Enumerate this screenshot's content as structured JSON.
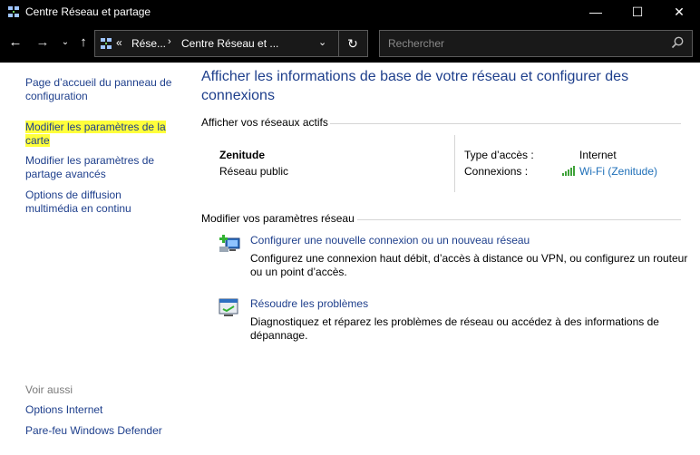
{
  "window": {
    "title": "Centre Réseau et partage",
    "controls": {
      "minimize": "—",
      "maximize": "☐",
      "close": "✕"
    }
  },
  "address_bar": {
    "back": "←",
    "forward": "→",
    "recent": "⌄",
    "up": "↑",
    "crumb_sep": "«",
    "crumb1": "Rése...",
    "crumb_arrow": "›",
    "crumb2": "Centre Réseau et ...",
    "dropdown": "⌄",
    "refresh": "↻",
    "search_placeholder": "Rechercher"
  },
  "sidebar": {
    "links": [
      {
        "label": "Page d’accueil du panneau de configuration"
      },
      {
        "label": "Modifier les paramètres de la carte"
      },
      {
        "label": "Modifier les paramètres de partage avancés"
      },
      {
        "label": "Options de diffusion multimédia en continu"
      }
    ],
    "see_also": "Voir aussi",
    "see_also_links": [
      {
        "label": "Options Internet"
      },
      {
        "label": "Pare-feu Windows Defender"
      }
    ]
  },
  "main": {
    "heading": "Afficher les informations de base de votre réseau et configurer des connexions",
    "active_networks": {
      "title": "Afficher vos réseaux actifs",
      "network_name": "Zenitude",
      "network_type": "Réseau public",
      "access_type_label": "Type d’accès :",
      "access_type_value": "Internet",
      "connections_label": "Connexions :",
      "connections_value": "Wi-Fi (Zenitude)"
    },
    "change_settings": {
      "title": "Modifier vos paramètres réseau",
      "tasks": [
        {
          "link": "Configurer une nouvelle connexion ou un nouveau réseau",
          "description": "Configurez une connexion haut débit, d’accès à distance ou VPN, ou configurez un routeur ou un point d’accès."
        },
        {
          "link": "Résoudre les problèmes",
          "description": "Diagnostiquez et réparez les problèmes de réseau ou accédez à des informations de dépannage."
        }
      ]
    }
  },
  "colors": {
    "link": "#1e3f8c",
    "highlight": "#ffff3b",
    "titlebar_bg": "#000000"
  }
}
